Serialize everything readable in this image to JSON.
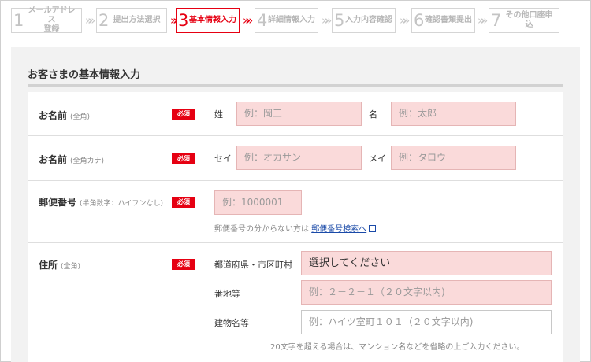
{
  "steps": [
    {
      "num": "1",
      "label": "メールアドレス登録",
      "label_l1": "メールアドレス",
      "label_l2": "登録"
    },
    {
      "num": "2",
      "label": "提出方法選択"
    },
    {
      "num": "3",
      "label": "基本情報入力"
    },
    {
      "num": "4",
      "label": "詳細情報入力"
    },
    {
      "num": "5",
      "label": "入力内容確認"
    },
    {
      "num": "6",
      "label": "確認書類提出"
    },
    {
      "num": "7",
      "label": "その他口座申込"
    }
  ],
  "arrow_glyph": "»»",
  "colors": {
    "accent": "#e60012",
    "input_bg": "#fadada",
    "link": "#1a4aa8"
  },
  "section": {
    "title": "お客さまの基本情報入力"
  },
  "required_badge": "必須",
  "rows": {
    "name": {
      "label": "お名前",
      "sub": "(全角)",
      "last_label": "姓",
      "last_placeholder": "例：岡三",
      "first_label": "名",
      "first_placeholder": "例：太郎"
    },
    "kana": {
      "label": "お名前",
      "sub": "(全角カナ)",
      "last_label": "セイ",
      "last_placeholder": "例：オカサン",
      "first_label": "メイ",
      "first_placeholder": "例：タロウ"
    },
    "postal": {
      "label": "郵便番号",
      "sub": "(半角数字：ハイフンなし)",
      "placeholder": "例：1000001",
      "help_text": "郵便番号の分からない方は",
      "help_link": "郵便番号検索へ"
    },
    "address": {
      "label": "住所",
      "sub": "(全角)",
      "pref_label": "都道府県・市区町村",
      "pref_value": "選択してください",
      "street_label": "番地等",
      "street_placeholder": "例：２－２－１（２０文字以内)",
      "building_label": "建物名等",
      "building_placeholder": "例：ハイツ室町１０１（２０文字以内)",
      "note": "20文字を超える場合は、マンション名などを省略の上ご入力ください。"
    }
  }
}
